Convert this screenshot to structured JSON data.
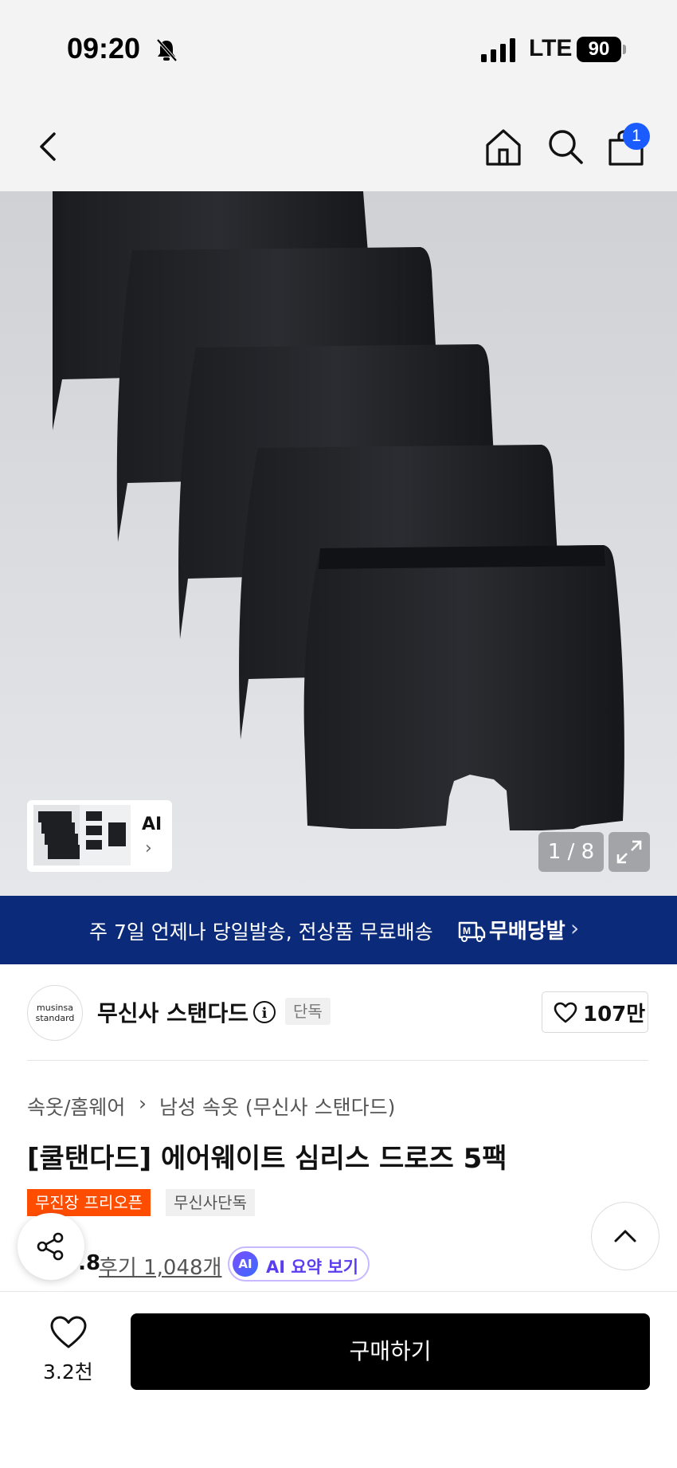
{
  "status_bar": {
    "time": "09:20",
    "network": "LTE",
    "battery": "90"
  },
  "nav": {
    "cart_count": "1",
    "icons": [
      "back-icon",
      "home-icon",
      "search-icon",
      "cart-icon"
    ]
  },
  "gallery": {
    "page_indicator": "1 / 8",
    "thumbnail_label": "AI",
    "thumbnail_chevron": "›"
  },
  "banner": {
    "text": "주 7일 언제나 당일발송, 전상품 무료배송",
    "brand": "무배당발",
    "chevron": "›"
  },
  "brand": {
    "logo_line1": "musinsa",
    "logo_line2": "standard",
    "name": "무신사 스탠다드",
    "info_symbol": "i",
    "exclusive_badge": "단독",
    "likes": "107만"
  },
  "product": {
    "breadcrumb": [
      "속옷/홈웨어",
      "남성 속옷 (무신사 스탠다드)"
    ],
    "breadcrumb_separator": "›",
    "title": "[쿨탠다드] 에어웨이트 심리스 드로즈 5팩",
    "tags": [
      "무진장 프리오픈",
      "무신사단독"
    ],
    "rating": "4.8",
    "reviews": "후기 1,048개",
    "ai_badge": "AI",
    "ai_summary": "AI 요약 보기"
  },
  "bottom_bar": {
    "like_count": "3.2천",
    "buy_label": "구매하기"
  },
  "colors": {
    "banner_bg": "#0b2a7a",
    "tag_orange": "#ff4d00",
    "badge_blue": "#1a5cff",
    "star": "#ff8a00",
    "ai_purple": "#5a3df0"
  }
}
